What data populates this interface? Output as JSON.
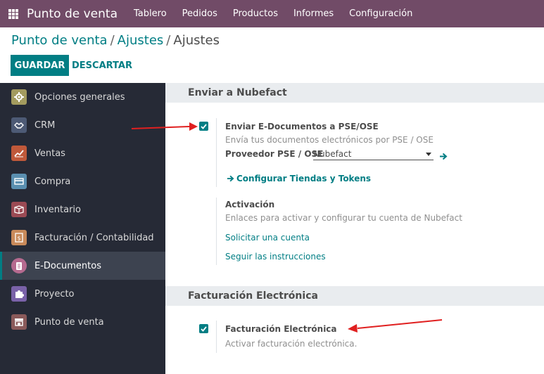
{
  "navbar": {
    "brand": "Punto de venta",
    "menu": [
      "Tablero",
      "Pedidos",
      "Productos",
      "Informes",
      "Configuración"
    ]
  },
  "breadcrumb": {
    "items": [
      "Punto de venta",
      "Ajustes"
    ],
    "current": "Ajustes",
    "separator": "/"
  },
  "actions": {
    "save": "GUARDAR",
    "discard": "DESCARTAR"
  },
  "sidebar": {
    "items": [
      {
        "label": "Opciones generales",
        "icon": "gear-icon",
        "color": "#a39b5f"
      },
      {
        "label": "CRM",
        "icon": "handshake-icon",
        "color": "#4d5a75"
      },
      {
        "label": "Ventas",
        "icon": "chart-line-icon",
        "color": "#c0593a"
      },
      {
        "label": "Compra",
        "icon": "credit-card-icon",
        "color": "#5a8fb0"
      },
      {
        "label": "Inventario",
        "icon": "box-icon",
        "color": "#9b4a54"
      },
      {
        "label": "Facturación / Contabilidad",
        "icon": "invoice-icon",
        "color": "#c98a5a"
      },
      {
        "label": "E-Documentos",
        "icon": "document-icon",
        "color": "#b56a8f"
      },
      {
        "label": "Proyecto",
        "icon": "puzzle-icon",
        "color": "#7a62a8"
      },
      {
        "label": "Punto de venta",
        "icon": "store-icon",
        "color": "#8a5a5a"
      }
    ],
    "active": "E-Documentos"
  },
  "sections": {
    "nubefact": {
      "title": "Enviar a Nubefact",
      "send": {
        "label": "Enviar E-Documentos a PSE/OSE",
        "description": "Envía tus documentos electrónicos por PSE / OSE",
        "checked": true,
        "provider_label": "Proveedor PSE / OSE",
        "provider_value": "Nubefact",
        "configure_link": "Configurar Tiendas y Tokens"
      },
      "activation": {
        "label": "Activación",
        "description": "Enlaces para activar y configurar tu cuenta de Nubefact",
        "link_account": "Solicitar una cuenta",
        "link_instructions": "Seguir las instrucciones"
      }
    },
    "einvoice": {
      "title": "Facturación Electrónica",
      "label": "Facturación Electrónica",
      "description": "Activar facturación electrónica.",
      "checked": true
    }
  },
  "colors": {
    "brand": "#714b67",
    "accent": "#017e84",
    "sidebar": "#262a36",
    "annotation": "#e02020"
  }
}
